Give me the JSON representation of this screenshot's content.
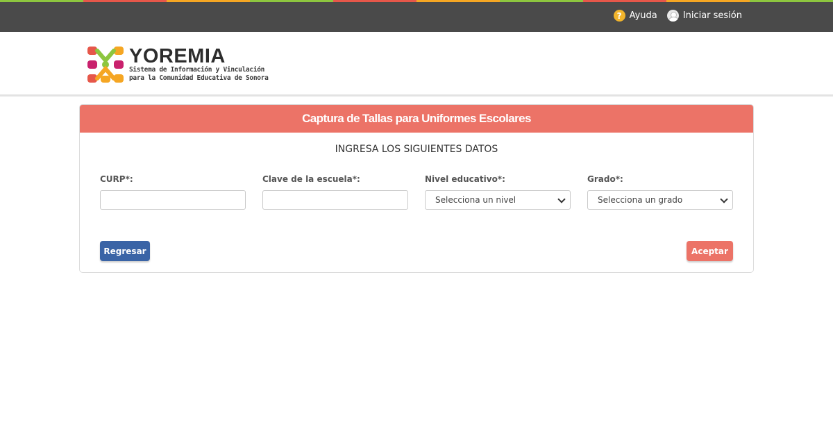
{
  "topbar": {
    "stripe_colors": [
      "#8dc63f",
      "#e6574a",
      "#f5a623",
      "#8dc63f",
      "#e6574a",
      "#f5a623",
      "#8dc63f",
      "#e6574a",
      "#f5a623",
      "#8dc63f"
    ],
    "help_label": "Ayuda",
    "help_icon": "question-circle-icon",
    "login_label": "Iniciar sesión",
    "login_icon": "user-icon"
  },
  "header": {
    "brand": "YOREMIA",
    "subtitle_line1": "Sistema de Información y Vinculación",
    "subtitle_line2": "para la Comunidad Educativa de Sonora"
  },
  "form": {
    "title": "Captura de Tallas para Uniformes Escolares",
    "subtitle": "INGRESA LOS SIGUIENTES DATOS",
    "curp_label": "CURP*:",
    "curp_value": "",
    "school_label": "Clave de la escuela*:",
    "school_value": "",
    "level_label": "Nivel educativo*:",
    "level_selected": "Selecciona un nivel",
    "grade_label": "Grado*:",
    "grade_selected": "Selecciona un grado",
    "back_button": "Regresar",
    "accept_button": "Aceptar"
  },
  "colors": {
    "accent": "#ec7367",
    "primary_button": "#3a64a6",
    "topbar": "#4a4a4a"
  }
}
